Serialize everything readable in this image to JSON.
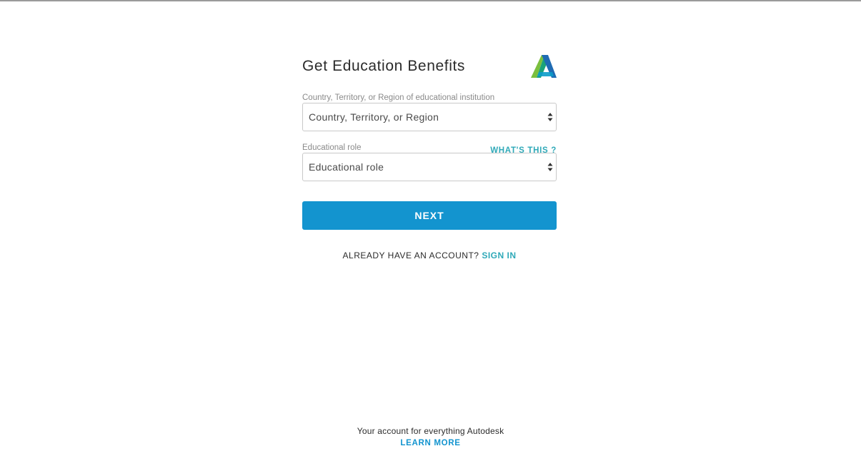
{
  "page": {
    "title": "Get Education Benefits",
    "logo_icon": "autodesk-logo-icon"
  },
  "form": {
    "country": {
      "label": "Country, Territory, or Region of educational institution",
      "selected": "Country, Territory, or Region"
    },
    "role": {
      "label": "Educational role",
      "help_link": "WHAT'S THIS ?",
      "selected": "Educational role"
    },
    "next_button": "NEXT"
  },
  "signin": {
    "prompt": "ALREADY HAVE AN ACCOUNT?",
    "link": "SIGN IN"
  },
  "footer": {
    "text": "Your account for everything Autodesk",
    "link": "LEARN MORE"
  },
  "colors": {
    "primary_button": "#1394cf",
    "teal_link": "#2fa9b8",
    "border": "#c9c9c9"
  }
}
